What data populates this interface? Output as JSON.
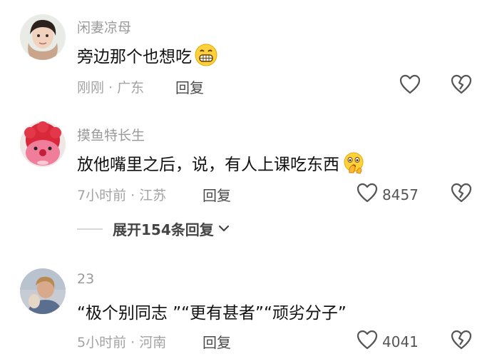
{
  "comments": [
    {
      "username": "闲妻凉母",
      "text": "旁边那个也想吃",
      "emoji": "grin-emoji",
      "time": "刚刚",
      "separator": "·",
      "location": "广东",
      "reply_label": "回复",
      "likes": ""
    },
    {
      "username": "摸鱼特长生",
      "text": "放他嘴里之后，说，有人上课吃东西",
      "emoji": "shush-emoji",
      "time": "7小时前",
      "separator": "·",
      "location": "江苏",
      "reply_label": "回复",
      "likes": "8457"
    },
    {
      "username": "23",
      "text": "“极个别同志 ”“更有甚者”“顽劣分子”",
      "time": "5小时前",
      "separator": "·",
      "location": "河南",
      "reply_label": "回复",
      "likes": "4041"
    }
  ],
  "expand_replies": {
    "label": "展开154条回复"
  },
  "icons": {
    "like": "heart-outline-icon",
    "dislike": "broken-heart-icon",
    "expand": "chevron-down-icon"
  },
  "colors": {
    "text": "#111111",
    "meta": "#a3a3a3",
    "icon": "#555555"
  }
}
